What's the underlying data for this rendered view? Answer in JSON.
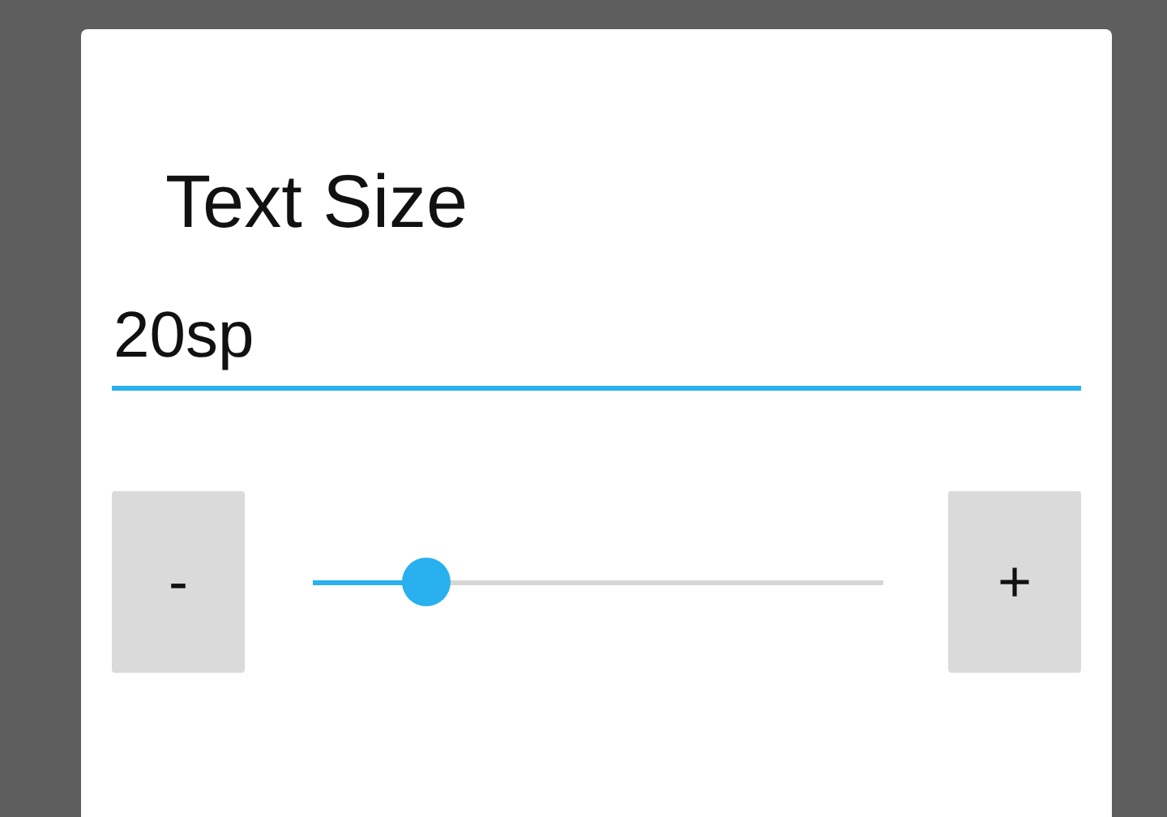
{
  "dialog": {
    "title": "Text Size",
    "field": {
      "value": "20sp"
    },
    "decrease_button": {
      "label": "-"
    },
    "slider": {
      "level": 0.2
    },
    "increase_button": {
      "label": "+"
    }
  }
}
